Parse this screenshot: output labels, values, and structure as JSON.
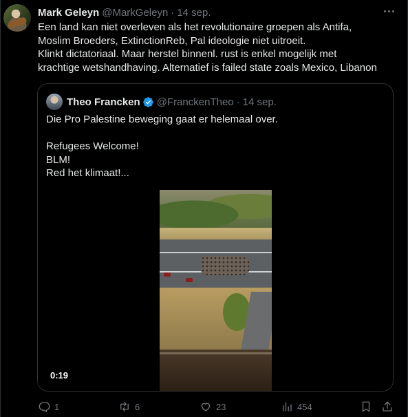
{
  "tweet": {
    "author_name": "Mark Geleyn",
    "author_handle": "@MarkGeleyn",
    "separator": "·",
    "date": "14 sep.",
    "text": "Een land kan niet overleven als het  revolutionaire groepen als Antifa,\nMoslim Broeders, ExtinctionReb, Pal ideologie niet uitroeit.\nKlinkt dictatoriaal. Maar herstel binnenl. rust is enkel mogelijk met\nkrachtige wetshandhaving. Alternatief is failed state zoals Mexico, Libanon"
  },
  "quote": {
    "author_name": "Theo Francken",
    "verified": true,
    "author_handle": "@FranckenTheo",
    "separator": "·",
    "date": "14 sep.",
    "text": "Die Pro Palestine beweging gaat er helemaal over.\n\nRefugees Welcome!\nBLM!\nRed het klimaat!...",
    "video_duration": "0:19"
  },
  "actions": {
    "replies": "1",
    "reposts": "6",
    "likes": "23",
    "views": "454"
  },
  "icons": {
    "more": "more-horizontal-icon",
    "reply": "reply-icon",
    "repost": "repost-icon",
    "like": "heart-icon",
    "views": "views-chart-icon",
    "bookmark": "bookmark-icon",
    "share": "share-icon",
    "verified": "verified-badge-icon"
  },
  "colors": {
    "background": "#000000",
    "text": "#e7e9ea",
    "muted": "#71767b",
    "border": "#2f3336",
    "verified": "#1d9bf0"
  }
}
